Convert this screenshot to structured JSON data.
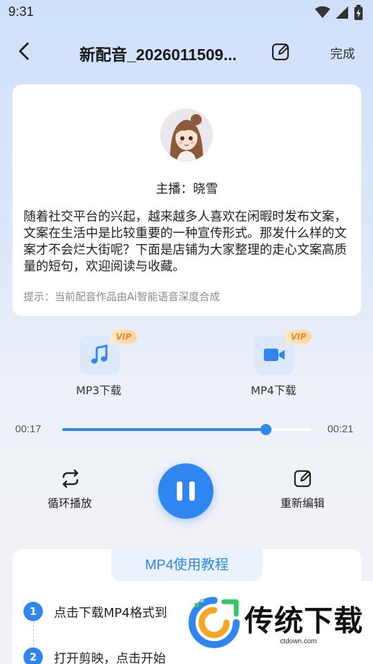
{
  "status_bar": {
    "time": "9:31",
    "icons": [
      "wifi-icon",
      "signal-icon",
      "battery-icon"
    ]
  },
  "header": {
    "title": "新配音_2026011509...",
    "done_label": "完成"
  },
  "card": {
    "anchor_label": "主播：晓雪",
    "script": "随着社交平台的兴起，越来越多人喜欢在闲暇时发布文案，文案在生活中是比较重要的一种宣传形式。那发什么样的文案才不会烂大街呢？下面是店铺为大家整理的走心文案高质量的短句，欢迎阅读与收藏。",
    "hint": "提示：当前配音作品由Ai智能语音深度合成"
  },
  "downloads": [
    {
      "label": "MP3下载",
      "badge": "VIP",
      "icon": "music-note-icon"
    },
    {
      "label": "MP4下载",
      "badge": "VIP",
      "icon": "video-camera-icon"
    }
  ],
  "player": {
    "current_time": "00:17",
    "total_time": "00:21",
    "progress": 0.82
  },
  "controls": {
    "loop_label": "循环播放",
    "reedit_label": "重新编辑",
    "state": "playing"
  },
  "tutorial": {
    "title": "MP4使用教程",
    "steps": [
      {
        "num": "1",
        "text": "点击下载MP4格式到"
      },
      {
        "num": "2",
        "text": "打开剪映，点击开始"
      }
    ]
  },
  "watermark": {
    "text": "传统下载",
    "url": "ctdown.com"
  },
  "colors": {
    "accent": "#2f86f0",
    "vip": "#e8892e"
  }
}
